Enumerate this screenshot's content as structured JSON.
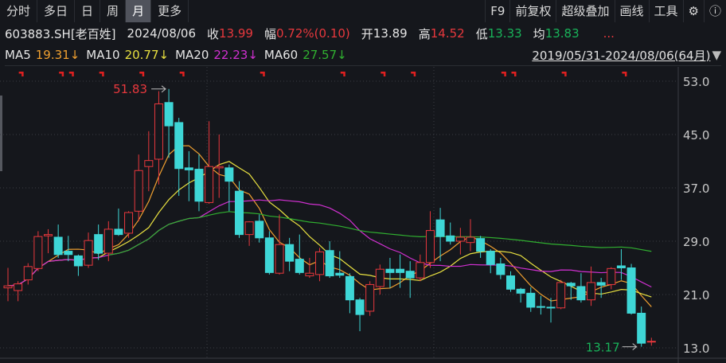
{
  "toolbar": {
    "tabs": [
      {
        "label": "分时"
      },
      {
        "label": "多日"
      },
      {
        "label": "日"
      },
      {
        "label": "周"
      },
      {
        "label": "月",
        "active": true
      },
      {
        "label": "更多"
      }
    ],
    "tools": [
      {
        "label": "F9"
      },
      {
        "label": "前复权"
      },
      {
        "label": "超级叠加"
      },
      {
        "label": "画线"
      },
      {
        "label": "工具"
      }
    ],
    "settings_icon": "gear-icon",
    "help_icon": "question-circle-icon"
  },
  "info": {
    "code": "603883.SH[老百姓]",
    "date": "2024/08/06",
    "close_label": "收",
    "close": "13.99",
    "change_label": "幅",
    "change": "0.72%(0.10)",
    "open_label": "开",
    "open": "13.89",
    "high_label": "高",
    "high": "14.52",
    "low_label": "低",
    "low": "13.33",
    "avg_label": "均",
    "avg": "13.83",
    "more": "..."
  },
  "ma": {
    "items": [
      {
        "label": "MA5",
        "value": "19.31↓",
        "color": "#f0a030"
      },
      {
        "label": "MA10",
        "value": "20.77↓",
        "color": "#e8e040"
      },
      {
        "label": "MA20",
        "value": "22.23↓",
        "color": "#d030d0"
      },
      {
        "label": "MA60",
        "value": "27.57↓",
        "color": "#30b030"
      }
    ],
    "range": "2019/05/31-2024/08/06(64月)",
    "range_arrow": "▼"
  },
  "colors": {
    "up": "#e8383d",
    "down": "#3ed6d6",
    "grid": "#3a3d44",
    "bg": "#15171c"
  },
  "chart_data": {
    "type": "candlestick",
    "ylim": [
      13.0,
      53.0
    ],
    "yticks": [
      "53.0",
      "45.0",
      "37.0",
      "29.0",
      "21.0",
      "13.0"
    ],
    "max_label": "51.83",
    "min_label": "13.17",
    "event_flags": [
      1,
      5,
      6,
      9,
      13,
      17,
      25,
      33,
      37,
      40,
      49,
      50,
      55,
      61
    ],
    "ohlc": [
      [
        22,
        25,
        20,
        22.3
      ],
      [
        21.6,
        23,
        20,
        22.6
      ],
      [
        23.2,
        25.7,
        22.5,
        25.2
      ],
      [
        24.9,
        30.5,
        24.5,
        29.7
      ],
      [
        29.8,
        30.8,
        27.2,
        30
      ],
      [
        29.6,
        31.5,
        26.5,
        27
      ],
      [
        27.5,
        29.8,
        26,
        27
      ],
      [
        26.8,
        27,
        23.8,
        25.3
      ],
      [
        25.4,
        30.3,
        25,
        29.1
      ],
      [
        30,
        31.5,
        26.2,
        27.2
      ],
      [
        27.2,
        32,
        26,
        30.8
      ],
      [
        30.8,
        33.9,
        29.8,
        30
      ],
      [
        30.2,
        33.5,
        29.5,
        33.3
      ],
      [
        33.5,
        42,
        32,
        39.6
      ],
      [
        40.2,
        45.5,
        36.5,
        41.1
      ],
      [
        41.3,
        51.5,
        37.5,
        49.6
      ],
      [
        49.8,
        51.83,
        41.5,
        46.3
      ],
      [
        46.8,
        47.5,
        35.8,
        39.9
      ],
      [
        40,
        42.5,
        35,
        39.7
      ],
      [
        39.8,
        42,
        33.5,
        35
      ],
      [
        34.8,
        47,
        34.6,
        40.2
      ],
      [
        40,
        45,
        35.5,
        40.2
      ],
      [
        40,
        40.5,
        33.5,
        38
      ],
      [
        36.5,
        38,
        29.5,
        30
      ],
      [
        30,
        32,
        28.3,
        31.9
      ],
      [
        32,
        33,
        28.8,
        29.5
      ],
      [
        29.5,
        30.5,
        24,
        24.3
      ],
      [
        24.2,
        33,
        24,
        28.5
      ],
      [
        28.5,
        29.5,
        24.5,
        26
      ],
      [
        26.3,
        30,
        24,
        24.3
      ],
      [
        23.8,
        26.5,
        23.5,
        24.2
      ],
      [
        24,
        28,
        23,
        27.4
      ],
      [
        27.6,
        29,
        23.5,
        23.8
      ],
      [
        24.2,
        27.5,
        23.5,
        23.9
      ],
      [
        23.7,
        24.2,
        18.2,
        20.2
      ],
      [
        20.2,
        20.5,
        15.5,
        18
      ],
      [
        18.5,
        23,
        17.8,
        22.5
      ],
      [
        22.2,
        25.5,
        21,
        24.8
      ],
      [
        24.8,
        26.5,
        22,
        24.3
      ],
      [
        24.8,
        27,
        22,
        24.3
      ],
      [
        24.5,
        26,
        20.5,
        23.5
      ],
      [
        23.5,
        27,
        23,
        25.8
      ],
      [
        25.8,
        33.5,
        25,
        30.6
      ],
      [
        32.2,
        34,
        26,
        29.7
      ],
      [
        29.8,
        31.8,
        28.5,
        29
      ],
      [
        29,
        31,
        27,
        29.6
      ],
      [
        28.8,
        32.3,
        27.5,
        29.6
      ],
      [
        29.4,
        29.8,
        26.5,
        27.5
      ],
      [
        27.5,
        27.8,
        24.2,
        25.5
      ],
      [
        25.6,
        26.5,
        23.3,
        24
      ],
      [
        23.8,
        24.5,
        21.4,
        21.8
      ],
      [
        21.8,
        22,
        19.8,
        21.2
      ],
      [
        21.2,
        22.1,
        18.4,
        19.1
      ],
      [
        19.2,
        20.8,
        18,
        19.1
      ],
      [
        19.1,
        20.5,
        16.8,
        19
      ],
      [
        19,
        23.2,
        18.8,
        22.8
      ],
      [
        22.7,
        22.9,
        20.2,
        22.3
      ],
      [
        22.2,
        24.2,
        19.8,
        20.2
      ],
      [
        20.2,
        25.2,
        19.3,
        22.8
      ],
      [
        22.8,
        23.5,
        20.5,
        22.4
      ],
      [
        22.5,
        25.1,
        21.8,
        24.9
      ],
      [
        25.3,
        27.8,
        23.2,
        25
      ],
      [
        25,
        25.6,
        18,
        18.2
      ],
      [
        18.2,
        19.2,
        13.17,
        13.7
      ],
      [
        13.89,
        14.52,
        13.33,
        13.99
      ]
    ]
  }
}
